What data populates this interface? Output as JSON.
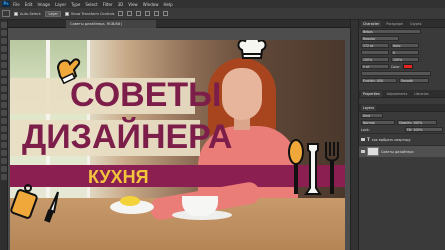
{
  "app": {
    "logo": "Ps"
  },
  "menu": [
    "File",
    "Edit",
    "Image",
    "Layer",
    "Type",
    "Select",
    "Filter",
    "3D",
    "View",
    "Window",
    "Help"
  ],
  "options": {
    "auto_select_label": "Auto-Select:",
    "auto_select_value": "Layer",
    "transform_label": "Show Transform Controls"
  },
  "document": {
    "tab_title": "Советы дизайнера, RGB/8#) "
  },
  "canvas_text": {
    "line1": "СОВЕТЫ",
    "line2": "ДИЗАЙНЕРА",
    "line3": "КУХНЯ"
  },
  "panels": {
    "char_tabs": [
      "Character",
      "Paragraph",
      "Glyphs"
    ],
    "font_family": "Bebas",
    "font_style": "Regular",
    "size": "172 pt",
    "leading": "Auto",
    "tracking": "0",
    "scale_v": "100%",
    "scale_h": "100%",
    "baseline": "0 pt",
    "color_label": "Color:",
    "language": "English: USA",
    "aa": "Smooth",
    "props_tabs": [
      "Properties",
      "Adjustments",
      "Libraries"
    ],
    "layers_tabs": [
      "Layers"
    ],
    "kind": "Kind",
    "blend": "Normal",
    "opacity": "Opacity: 100%",
    "lock": "Lock:",
    "fill": "Fill: 100%",
    "layers": [
      {
        "name": "как выбрать квартиру"
      },
      {
        "name": "Советы дизайнера"
      }
    ]
  },
  "icons": {
    "chef_hat": "chef-hat-icon",
    "oven_mitt": "oven-mitt-icon",
    "cutting_board": "cutting-board-icon",
    "knife": "knife-icon",
    "cutlery": "cutlery-icon"
  },
  "colors": {
    "title_color": "#7c1d4a",
    "band_color": "#8b1f52",
    "subtitle_color": "#f2c53d",
    "icon_orange": "#f0a83a"
  }
}
